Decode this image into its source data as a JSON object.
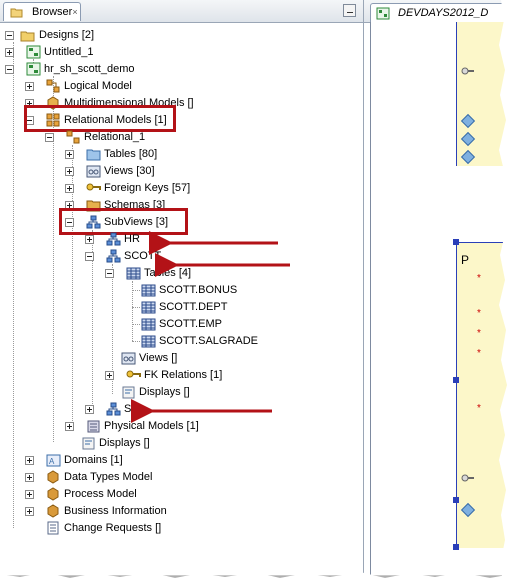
{
  "browser_tab": {
    "label": "Browser",
    "close": "×"
  },
  "editor_tab": {
    "label": "DEVDAYS2012_D"
  },
  "tree": {
    "designs": "Designs [2]",
    "untitled": "Untitled_1",
    "hr_demo": "hr_sh_scott_demo",
    "logical": "Logical Model",
    "multidim": "Multidimensional Models []",
    "relational_models": "Relational Models [1]",
    "relational_1": "Relational_1",
    "tables": "Tables [80]",
    "views": "Views [30]",
    "foreign_keys": "Foreign Keys [57]",
    "schemas": "Schemas [3]",
    "subviews": "SubViews [3]",
    "hr": "HR",
    "scott": "SCOTT",
    "scott_tables": "Tables [4]",
    "bonus": "SCOTT.BONUS",
    "dept": "SCOTT.DEPT",
    "emp": "SCOTT.EMP",
    "salgrade": "SCOTT.SALGRADE",
    "scott_views": "Views []",
    "fk_relations": "FK Relations [1]",
    "scott_displays": "Displays []",
    "sh": "SH",
    "physical": "Physical Models [1]",
    "displays": "Displays []",
    "domains": "Domains [1]",
    "data_types": "Data Types Model",
    "process": "Process Model",
    "business": "Business Information",
    "change_requests": "Change Requests []"
  },
  "canvas": {
    "p_label": "P"
  },
  "colors": {
    "highlight": "#b31217",
    "arrow": "#b31217",
    "table_fill": "#fcf7c9",
    "selection": "#2a3fb8"
  }
}
